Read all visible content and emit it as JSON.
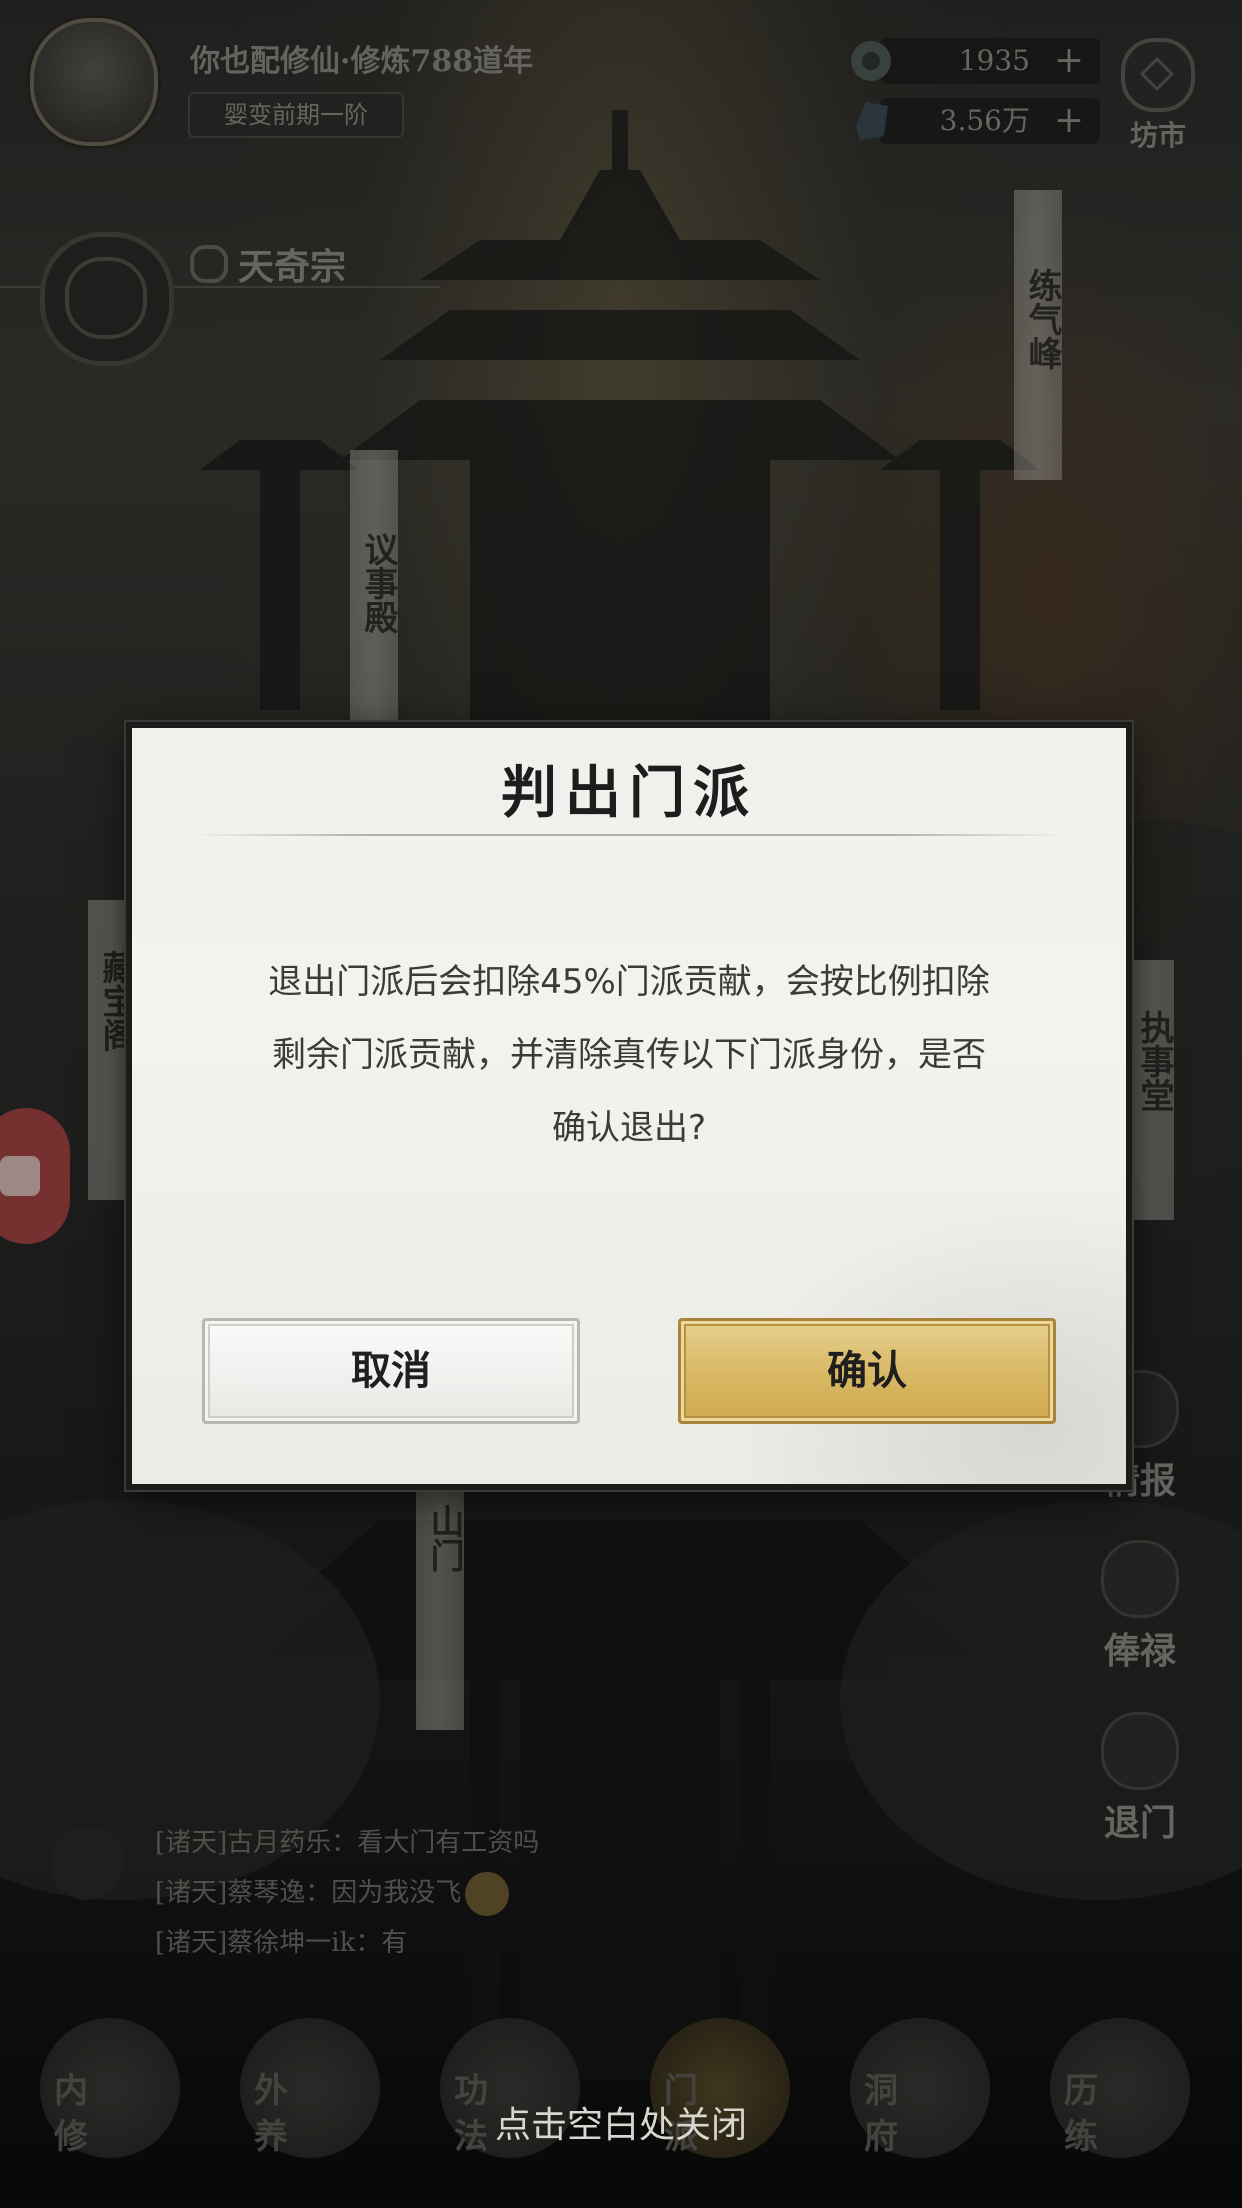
{
  "hud": {
    "player_name": "你也配修仙·修炼788道年",
    "realm": "婴变前期一阶",
    "currency_1": {
      "value": "1935",
      "plus": "+",
      "icon": "jade-flower-icon"
    },
    "currency_2": {
      "value": "3.56万",
      "plus": "+",
      "icon": "spirit-stone-icon"
    },
    "market_label": "坊市"
  },
  "sect": {
    "name": "天奇宗"
  },
  "buildings": {
    "lianqi": "练气峰",
    "yishi": "议事殿",
    "zangbao": "藏宝阁",
    "zhishi": "执事堂",
    "shanmen": "山门"
  },
  "side_menu": [
    {
      "label": "情报",
      "icon": "scroll-icon"
    },
    {
      "label": "俸禄",
      "icon": "coin-icon"
    },
    {
      "label": "退门",
      "icon": "crane-icon"
    }
  ],
  "chat": [
    {
      "channel": "[诸天]",
      "text": "古月药乐：看大门有工资吗"
    },
    {
      "channel": "[诸天]",
      "text": "蔡琴逸：因为我没飞"
    },
    {
      "channel": "[诸天]",
      "text": "蔡徐坤一ik：有"
    }
  ],
  "bottom_nav": [
    {
      "label": "内修"
    },
    {
      "label": "外养"
    },
    {
      "label": "功法"
    },
    {
      "label": "门派"
    },
    {
      "label": "洞府"
    },
    {
      "label": "历练"
    }
  ],
  "dialog": {
    "title": "判出门派",
    "body_line1": "退出门派后会扣除45%门派贡献，会按比例扣除",
    "body_line2": "剩余门派贡献，并清除真传以下门派身份，是否",
    "body_line3": "确认退出?",
    "cancel_label": "取消",
    "confirm_label": "确认"
  },
  "close_hint": "点击空白处关闭"
}
